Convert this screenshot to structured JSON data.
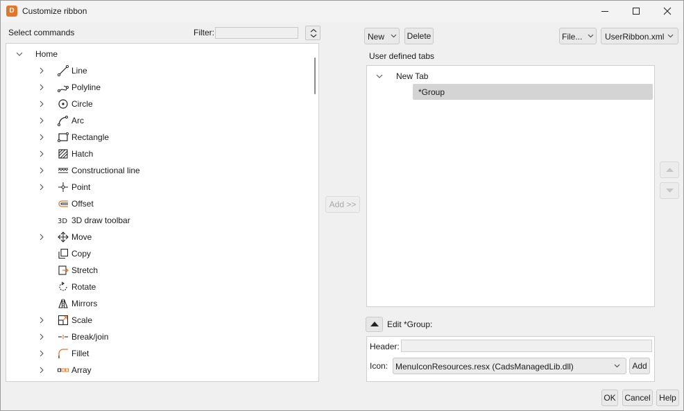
{
  "window": {
    "title": "Customize ribbon",
    "app_icon_letter": "D"
  },
  "left": {
    "select_label": "Select commands",
    "filter_label": "Filter:",
    "filter_value": "",
    "tree": {
      "root": "Home",
      "items": [
        {
          "label": "Line",
          "icon": "line-icon",
          "expandable": true
        },
        {
          "label": "Polyline",
          "icon": "polyline-icon",
          "expandable": true
        },
        {
          "label": "Circle",
          "icon": "circle-icon",
          "expandable": true
        },
        {
          "label": "Arc",
          "icon": "arc-icon",
          "expandable": true
        },
        {
          "label": "Rectangle",
          "icon": "rectangle-icon",
          "expandable": true
        },
        {
          "label": "Hatch",
          "icon": "hatch-icon",
          "expandable": true
        },
        {
          "label": "Constructional line",
          "icon": "constructional-line-icon",
          "expandable": true
        },
        {
          "label": "Point",
          "icon": "point-icon",
          "expandable": true
        },
        {
          "label": "Offset",
          "icon": "offset-icon",
          "expandable": false
        },
        {
          "label": "3D draw toolbar",
          "icon": "3d-draw-icon",
          "expandable": false
        },
        {
          "label": "Move",
          "icon": "move-icon",
          "expandable": true
        },
        {
          "label": "Copy",
          "icon": "copy-icon",
          "expandable": false
        },
        {
          "label": "Stretch",
          "icon": "stretch-icon",
          "expandable": false
        },
        {
          "label": "Rotate",
          "icon": "rotate-icon",
          "expandable": false
        },
        {
          "label": "Mirrors",
          "icon": "mirror-icon",
          "expandable": false
        },
        {
          "label": "Scale",
          "icon": "scale-icon",
          "expandable": true
        },
        {
          "label": "Break/join",
          "icon": "break-join-icon",
          "expandable": true
        },
        {
          "label": "Fillet",
          "icon": "fillet-icon",
          "expandable": true
        },
        {
          "label": "Array",
          "icon": "array-icon",
          "expandable": true
        }
      ]
    }
  },
  "middle": {
    "add_button": "Add >>"
  },
  "right": {
    "new_button": "New",
    "delete_button": "Delete",
    "file_button": "File...",
    "ribbon_file": "UserRibbon.xml",
    "tabs_label": "User defined tabs",
    "tree": {
      "tab": "New Tab",
      "group": "*Group"
    },
    "edit_label": "Edit *Group:",
    "header_label": "Header:",
    "header_value": "",
    "icon_label": "Icon:",
    "icon_value": "MenuIconResources.resx (CadsManagedLib.dll)",
    "icon_add_button": "Add"
  },
  "footer": {
    "ok": "OK",
    "cancel": "Cancel",
    "help": "Help"
  },
  "colors": {
    "accent_orange": "#e4762b",
    "selection_gray": "#d4d4d4"
  }
}
